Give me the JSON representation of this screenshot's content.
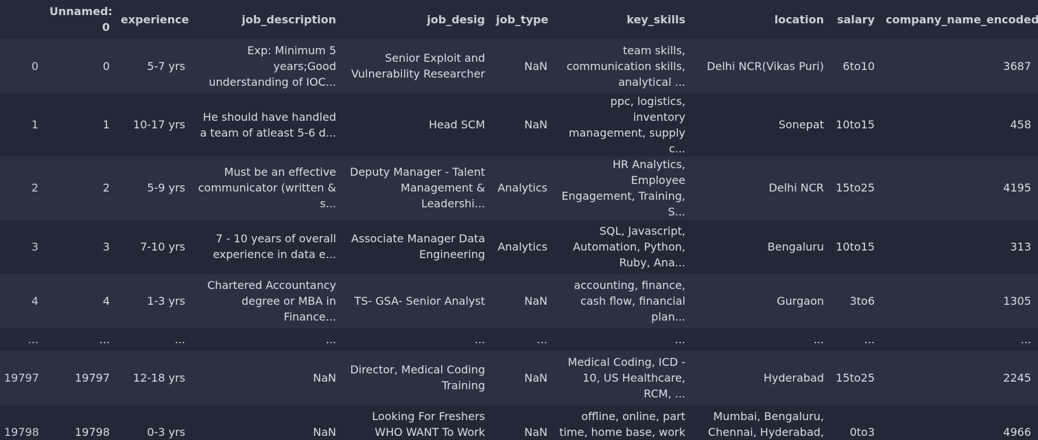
{
  "columns": [
    "",
    "Unnamed:\n0",
    "experience",
    "job_description",
    "job_desig",
    "job_type",
    "key_skills",
    "location",
    "salary",
    "company_name_encoded"
  ],
  "rows": [
    [
      "0",
      "0",
      "5-7 yrs",
      "Exp: Minimum 5\nyears;Good\nunderstanding of IOC...",
      "Senior Exploit and\nVulnerability Researcher",
      "NaN",
      "team skills,\ncommunication skills,\nanalytical ...",
      "Delhi NCR(Vikas Puri)",
      "6to10",
      "3687"
    ],
    [
      "1",
      "1",
      "10-17 yrs",
      "He should have handled\na team of atleast 5-6 d...",
      "Head SCM",
      "NaN",
      "ppc, logistics, inventory\nmanagement, supply\nc...",
      "Sonepat",
      "10to15",
      "458"
    ],
    [
      "2",
      "2",
      "5-9 yrs",
      "Must be an effective\ncommunicator (written &\ns...",
      "Deputy Manager - Talent\nManagement &\nLeadershi...",
      "Analytics",
      "HR Analytics, Employee\nEngagement, Training,\nS...",
      "Delhi NCR",
      "15to25",
      "4195"
    ],
    [
      "3",
      "3",
      "7-10 yrs",
      "7 - 10 years of overall\nexperience in data e...",
      "Associate Manager Data\nEngineering",
      "Analytics",
      "SQL, Javascript,\nAutomation, Python,\nRuby, Ana...",
      "Bengaluru",
      "10to15",
      "313"
    ],
    [
      "4",
      "4",
      "1-3 yrs",
      "Chartered Accountancy\ndegree or MBA in\nFinance...",
      "TS- GSA- Senior Analyst",
      "NaN",
      "accounting, finance,\ncash flow, financial\nplan...",
      "Gurgaon",
      "3to6",
      "1305"
    ],
    [
      "...",
      "...",
      "...",
      "...",
      "...",
      "...",
      "...",
      "...",
      "...",
      "..."
    ],
    [
      "19797",
      "19797",
      "12-18 yrs",
      "NaN",
      "Director, Medical Coding\nTraining",
      "NaN",
      "Medical Coding, ICD -\n10, US Healthcare,\nRCM, ...",
      "Hyderabad",
      "15to25",
      "2245"
    ],
    [
      "19798",
      "19798",
      "0-3 yrs",
      "NaN",
      "Looking For Freshers\nWHO WANT To Work\nWITH US",
      "NaN",
      "offline, online, part\ntime, home base, work\nfr...",
      "Mumbai, Bengaluru,\nChennai, Hyderabad,\nDehradu...",
      "0to3",
      "4966"
    ]
  ]
}
